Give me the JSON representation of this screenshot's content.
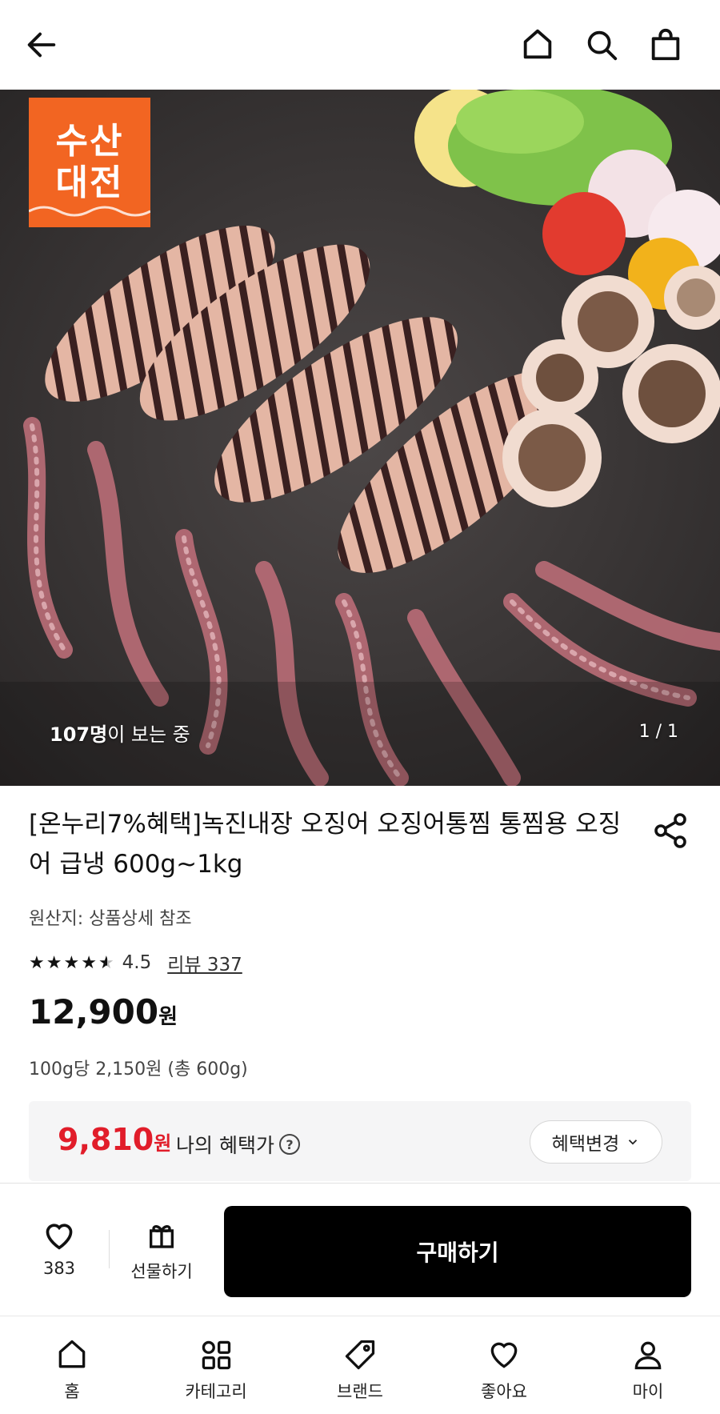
{
  "header": {
    "back_icon": "arrow-left-icon",
    "home_icon": "home-icon",
    "search_icon": "search-icon",
    "cart_icon": "shopping-bag-icon"
  },
  "hero": {
    "badge_line1": "수산",
    "badge_line2": "대전",
    "viewers_count": "107명",
    "viewers_suffix": "이 보는 중",
    "pager": "1 / 1",
    "badge_color": "#f26522"
  },
  "product": {
    "title": "[온누리7%혜택]녹진내장 오징어 오징어통찜 통찜용 오징어 급냉 600g~1kg",
    "origin": "원산지: 상품상세 참조",
    "rating": "4.5",
    "rating_value": 4.5,
    "review_label": "리뷰 337",
    "price": "12,900",
    "price_unit": "원",
    "unit_price": "100g당 2,150원 (총 600g)"
  },
  "benefit": {
    "price": "9,810",
    "price_unit": "원",
    "label": "나의 혜택가",
    "help_icon": "question-circle-icon",
    "change_button": "혜택변경",
    "accent_color": "#e11d2a"
  },
  "actions": {
    "like_count": "383",
    "gift_label": "선물하기",
    "buy_label": "구매하기"
  },
  "nav": {
    "items": [
      {
        "label": "홈",
        "icon": "home-icon"
      },
      {
        "label": "카테고리",
        "icon": "category-grid-icon"
      },
      {
        "label": "브랜드",
        "icon": "tag-icon"
      },
      {
        "label": "좋아요",
        "icon": "heart-icon"
      },
      {
        "label": "마이",
        "icon": "user-icon"
      }
    ]
  }
}
